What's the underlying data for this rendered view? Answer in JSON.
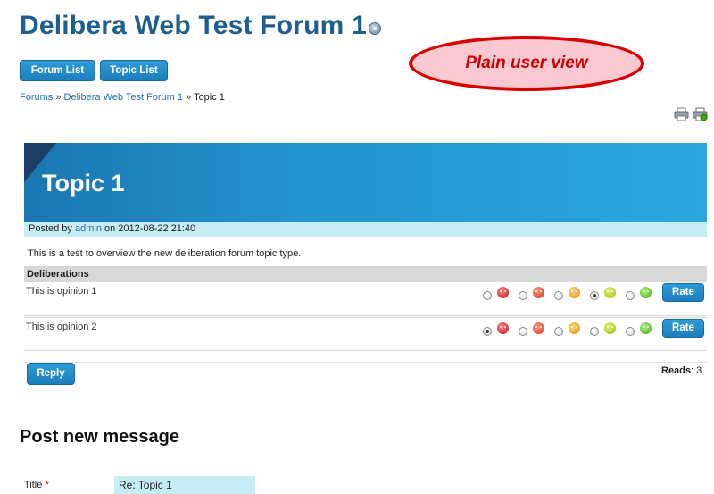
{
  "page": {
    "title": "Delibera Web Test Forum 1",
    "help_icon": "help-icon"
  },
  "nav": {
    "forum_list": "Forum List",
    "topic_list": "Topic List"
  },
  "annotation": {
    "text": "Plain user view"
  },
  "breadcrumb": {
    "items": [
      "Forums",
      "Delibera Web Test Forum 1",
      "Topic 1"
    ],
    "separator": "»"
  },
  "toolbar": {
    "icons": [
      "print-icon",
      "print-preview-icon"
    ]
  },
  "topic": {
    "title": "Topic 1",
    "posted_prefix": "Posted by",
    "author": "admin",
    "posted_on": "on 2012-08-22 21:40",
    "body": "This is a test to overview the new deliberation forum topic type."
  },
  "deliberations": {
    "header": "Deliberations",
    "rate_label": "Rate",
    "scale": [
      "very-bad",
      "bad",
      "neutral",
      "good",
      "very-good"
    ],
    "opinions": [
      {
        "text": "This is opinion 1",
        "selected": "good"
      },
      {
        "text": "This is opinion 2",
        "selected": "very-bad"
      }
    ]
  },
  "actions": {
    "reply": "Reply",
    "reads_label": "Reads",
    "reads_value": "3"
  },
  "post_form": {
    "heading": "Post new message",
    "title_label": "Title",
    "required_marker": "*",
    "title_value": "Re: Topic 1"
  },
  "colors": {
    "brand_blue": "#1f5f8f",
    "button_blue": "#2288c8",
    "banner_blue": "#2394cd",
    "light_cyan": "#c6ecf5",
    "annotation_red": "#d90000"
  }
}
